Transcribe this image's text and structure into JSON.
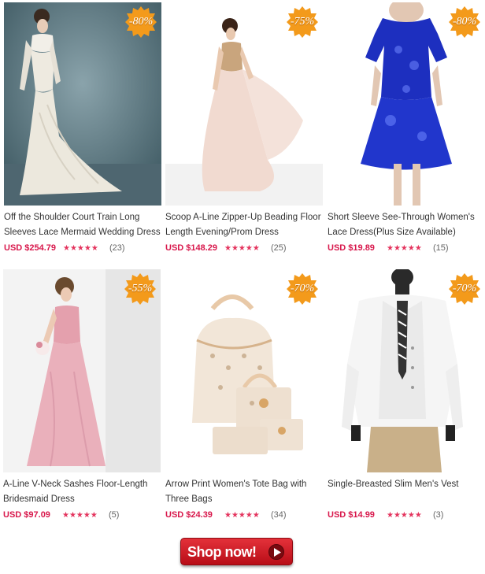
{
  "products": [
    {
      "discount": "-80%",
      "title_lines": [
        "Off the Shoulder Court Train Long",
        "Sleeves Lace Mermaid Wedding Dress"
      ],
      "price": "USD $254.79",
      "stars": "★★★★★",
      "reviews": "(23)",
      "rating": 5,
      "image": "white-lace-wedding-dress"
    },
    {
      "discount": "-75%",
      "title_lines": [
        "Scoop A-Line Zipper-Up Beading Floor",
        "Length Evening/Prom Dress"
      ],
      "price": "USD $148.29",
      "stars": "★★★★★",
      "reviews": "(25)",
      "rating": 5,
      "image": "blush-prom-dress"
    },
    {
      "discount": "-80%",
      "title_lines": [
        "Short Sleeve See-Through Women's",
        "Lace Dress(Plus Size Available)"
      ],
      "price": "USD $19.89",
      "stars": "★★★★★",
      "reviews": "(15)",
      "rating": 5,
      "image": "blue-lace-dress"
    },
    {
      "discount": "-55%",
      "title_lines": [
        "A-Line V-Neck Sashes Floor-Length",
        "Bridesmaid Dress"
      ],
      "price": "USD $97.09",
      "stars": "★★★★★",
      "reviews": "(5)",
      "rating": 5,
      "image": "pink-bridesmaid-dress"
    },
    {
      "discount": "-70%",
      "title_lines": [
        "Arrow Print Women's Tote Bag with",
        "Three Bags"
      ],
      "price": "USD $24.39",
      "stars": "★★★★★",
      "reviews": "(34)",
      "rating": 5,
      "image": "tote-bag-set"
    },
    {
      "discount": "-70%",
      "title_lines": [
        "Single-Breasted Slim Men's Vest",
        ""
      ],
      "price": "USD $14.99",
      "stars": "★★★★★",
      "reviews": "(3)",
      "rating": 5,
      "image": "mens-vest"
    }
  ],
  "cta": {
    "label": "Shop now!",
    "icon": "play-arrow-icon"
  },
  "colors": {
    "price": "#d8174b",
    "stars": "#e4345e",
    "badge": "#f39a1b",
    "button": "#c81d26"
  }
}
